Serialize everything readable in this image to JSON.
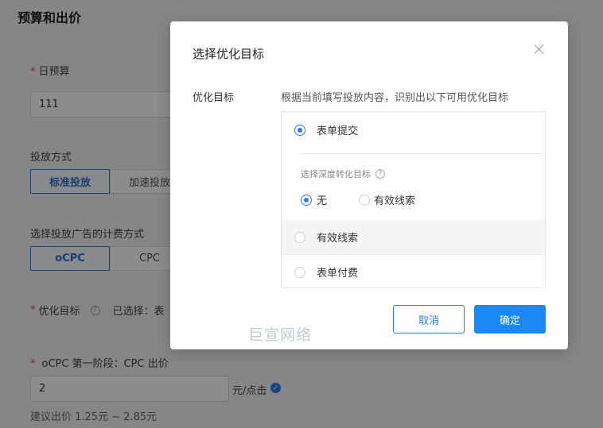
{
  "page": {
    "section_title": "预算和出价",
    "daily_budget": {
      "label": "日预算",
      "value": "111"
    },
    "delivery_mode": {
      "label": "投放方式",
      "options": [
        "标准投放",
        "加速投放"
      ]
    },
    "billing_mode": {
      "label": "选择投放广告的计费方式",
      "options": [
        "oCPC",
        "CPC"
      ]
    },
    "optimization": {
      "label": "优化目标",
      "selected_prefix": "已选择：表"
    },
    "ocpc_bid": {
      "label": "oCPC 第一阶段：CPC 出价",
      "value": "2",
      "unit": "元/点击",
      "suggestion": "建议出价 1.25元 ~ 2.85元"
    }
  },
  "modal": {
    "title": "选择优化目标",
    "field_label": "优化目标",
    "hint": "根据当前填写投放内容，识别出以下可用优化目标",
    "options": [
      {
        "label": "表单提交",
        "selected": true
      },
      {
        "label": "有效线索",
        "selected": false
      },
      {
        "label": "表单付费",
        "selected": false
      }
    ],
    "deep_conversion": {
      "title": "选择深度转化目标",
      "options": [
        {
          "label": "无",
          "selected": true
        },
        {
          "label": "有效线索",
          "selected": false
        }
      ]
    },
    "cancel_label": "取消",
    "ok_label": "确定",
    "watermark": "巨宣网络"
  },
  "colors": {
    "accent": "#1a88f5",
    "required": "#e8484a",
    "hover_bg": "#f5f5f5"
  }
}
